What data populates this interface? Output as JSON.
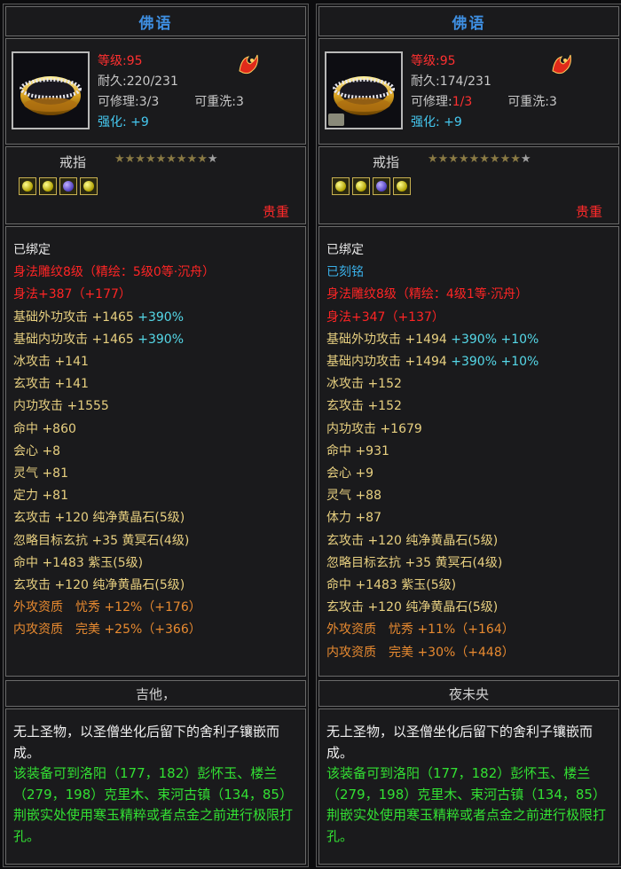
{
  "colors": {
    "title": "#3e8ee0",
    "red": "#ff3030",
    "cyan": "#45c8f0",
    "yellow": "#e8d080",
    "orange": "#e88a30",
    "green": "#33e033"
  },
  "left": {
    "title": "佛语",
    "level": "等级:95",
    "durability": "耐久:220/231",
    "repair_label": "可修理:",
    "repair_value": "3/3",
    "rewash": "可重洗:3",
    "enhance_label": "强化:",
    "enhance_value": "+9",
    "item_type": "戒指",
    "stars_filled": "★★★★★★★★★",
    "stars_empty": "★",
    "rarity": "贵重",
    "stats": [
      {
        "text": "已绑定",
        "cls": "w"
      },
      {
        "text": "身法雕纹8级（精绘：5级0等·沉舟）",
        "cls": "r"
      },
      {
        "text": "身法+387（+177）",
        "cls": "r"
      },
      {
        "text": "基础外功攻击 +1465",
        "cls": "y",
        "extra": "+390%"
      },
      {
        "text": "基础内功攻击 +1465",
        "cls": "y",
        "extra": "+390%"
      },
      {
        "text": "冰攻击 +141",
        "cls": "y"
      },
      {
        "text": "玄攻击 +141",
        "cls": "y"
      },
      {
        "text": "内功攻击 +1555",
        "cls": "y"
      },
      {
        "text": "命中 +860",
        "cls": "y"
      },
      {
        "text": "会心 +8",
        "cls": "y"
      },
      {
        "text": "灵气 +81",
        "cls": "y"
      },
      {
        "text": "定力 +81",
        "cls": "y"
      },
      {
        "text": "玄攻击 +120 纯净黄晶石(5级)",
        "cls": "y"
      },
      {
        "text": "忽略目标玄抗 +35 黄冥石(4级)",
        "cls": "y"
      },
      {
        "text": "命中 +1483 紫玉(5级)",
        "cls": "y"
      },
      {
        "text": "玄攻击 +120 纯净黄晶石(5级)",
        "cls": "y"
      },
      {
        "text": "外攻资质　忧秀 +12%（+176）",
        "cls": "o"
      },
      {
        "text": "内攻资质　完美 +25%（+366）",
        "cls": "o"
      }
    ],
    "owner": "吉他，",
    "desc_intro": "无上圣物，以圣僧坐化后留下的舍利子镶嵌而成。",
    "desc_hint": "该装备可到洛阳（177，182）彭怀玉、楼兰（279，198）克里木、束河古镇（134，85）荆嵌实处使用寒玉精粹或者点金之前进行极限打孔。"
  },
  "right": {
    "title": "佛语",
    "level": "等级:95",
    "durability": "耐久:174/231",
    "repair_label": "可修理:",
    "repair_value": "1/3",
    "rewash": "可重洗:3",
    "enhance_label": "强化:",
    "enhance_value": "+9",
    "item_type": "戒指",
    "stars_filled": "★★★★★★★★★",
    "stars_empty": "★",
    "rarity": "贵重",
    "stats": [
      {
        "text": "已绑定",
        "cls": "w"
      },
      {
        "text": "已刻铭",
        "cls": "b"
      },
      {
        "text": "身法雕纹8级（精绘：4级1等·沉舟）",
        "cls": "r"
      },
      {
        "text": "身法+347（+137）",
        "cls": "r"
      },
      {
        "text": "基础外功攻击 +1494",
        "cls": "y",
        "extra": "+390% +10%"
      },
      {
        "text": "基础内功攻击 +1494",
        "cls": "y",
        "extra": "+390% +10%"
      },
      {
        "text": "冰攻击 +152",
        "cls": "y"
      },
      {
        "text": "玄攻击 +152",
        "cls": "y"
      },
      {
        "text": "内功攻击 +1679",
        "cls": "y"
      },
      {
        "text": "命中 +931",
        "cls": "y"
      },
      {
        "text": "会心 +9",
        "cls": "y"
      },
      {
        "text": "灵气 +88",
        "cls": "y"
      },
      {
        "text": "体力 +87",
        "cls": "y"
      },
      {
        "text": "玄攻击 +120 纯净黄晶石(5级)",
        "cls": "y"
      },
      {
        "text": "忽略目标玄抗 +35 黄冥石(4级)",
        "cls": "y"
      },
      {
        "text": "命中 +1483 紫玉(5级)",
        "cls": "y"
      },
      {
        "text": "玄攻击 +120 纯净黄晶石(5级)",
        "cls": "y"
      },
      {
        "text": "外攻资质　忧秀 +11%（+164）",
        "cls": "o"
      },
      {
        "text": "内攻资质　完美 +30%（+448）",
        "cls": "o"
      }
    ],
    "owner": "夜未央",
    "desc_intro": "无上圣物，以圣僧坐化后留下的舍利子镶嵌而成。",
    "desc_hint": "该装备可到洛阳（177，182）彭怀玉、楼兰（279，198）克里木、束河古镇（134，85）荆嵌实处使用寒玉精粹或者点金之前进行极限打孔。"
  }
}
